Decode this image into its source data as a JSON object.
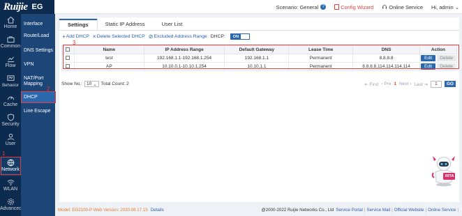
{
  "header": {
    "logo": "Ruijie",
    "product": "EG",
    "scenario_label": "Scenario: General",
    "help_icon": "question-circle-icon",
    "config_wizard": "Config Wizard",
    "online_service": "Online Service",
    "user": "Hi, admin"
  },
  "rail": [
    {
      "label": "Home",
      "icon": "home-icon"
    },
    {
      "label": "Common",
      "icon": "briefcase-icon"
    },
    {
      "label": "Flow",
      "icon": "flow-icon"
    },
    {
      "label": "Behavior",
      "icon": "behavior-icon"
    },
    {
      "label": "Cache",
      "icon": "gauge-icon"
    },
    {
      "label": "Security",
      "icon": "shield-icon"
    },
    {
      "label": "User",
      "icon": "user-icon"
    },
    {
      "label": "Network",
      "icon": "globe-icon"
    },
    {
      "label": "WLAN",
      "icon": "wifi-icon"
    },
    {
      "label": "Advanced",
      "icon": "gear-icon"
    }
  ],
  "submenu": [
    {
      "label": "Interface"
    },
    {
      "label": "Route/Load"
    },
    {
      "label": "DNS Settings"
    },
    {
      "label": "VPN"
    },
    {
      "label": "NAT/Port Mapping"
    },
    {
      "label": "DHCP"
    },
    {
      "label": "Line Escape"
    }
  ],
  "annotations": {
    "step1": "1",
    "step2": "2",
    "step3": "3"
  },
  "tabs": [
    {
      "label": "Settings"
    },
    {
      "label": "Static IP Address"
    },
    {
      "label": "User List"
    }
  ],
  "toolbar": {
    "add": "Add DHCP",
    "delete_selected": "Delete Selected DHCP",
    "excluded": "Excluded Address Range",
    "dhcp_label": "DHCP:",
    "dhcp_state": "ON"
  },
  "table": {
    "columns": [
      "Name",
      "IP Address Range",
      "Default Gateway",
      "Lease Time",
      "DNS",
      "Action"
    ],
    "rows": [
      {
        "name": "test",
        "range": "192.168.1.1-192.168.1.254",
        "gateway": "192.168.1.1",
        "lease": "Permanent",
        "dns": "8.8.8.8"
      },
      {
        "name": "AP",
        "range": "10.10.0.1-10.10.1.254",
        "gateway": "10.10.1.1",
        "lease": "Permanent",
        "dns": "8.8.8.8,114.114.114.114"
      }
    ],
    "edit_label": "Edit",
    "delete_label": "Delete"
  },
  "pager": {
    "show_no": "Show No.:",
    "page_size": "10",
    "total": "Total Count: 2",
    "first": "First",
    "pre": "Pre",
    "current": "1",
    "next": "Next",
    "last": "Last",
    "input": "1",
    "go": "GO"
  },
  "robot": {
    "label": "RITA"
  },
  "footer": {
    "model": "Model: EG2100-P  Web Version: 2020.08.17.15",
    "details": "Details",
    "copyright": "@2000-2022 Ruijie Networks Co., Ltd",
    "service_portal": "Service Portal",
    "service_mail": "Service Mail",
    "official_website": "Official Website",
    "online_service": "Online Service"
  }
}
